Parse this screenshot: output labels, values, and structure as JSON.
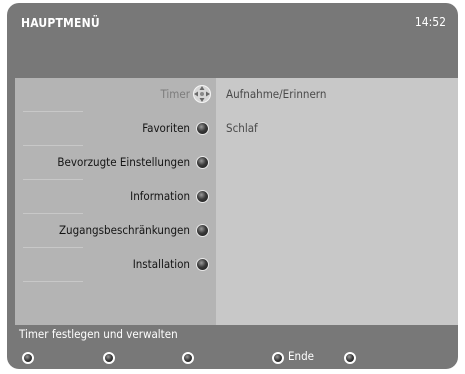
{
  "header": {
    "title": "HAUPTMENÜ",
    "time": "14:52"
  },
  "menu": {
    "items": [
      {
        "label": "Timer",
        "selected": true
      },
      {
        "label": "Favoriten"
      },
      {
        "label": "Bevorzugte Einstellungen"
      },
      {
        "label": "Information"
      },
      {
        "label": "Zugangsbeschränkungen"
      },
      {
        "label": "Installation"
      }
    ]
  },
  "submenu": {
    "items": [
      "Aufnahme/Erinnern",
      "Schlaf"
    ]
  },
  "status": {
    "text": "Timer festlegen und verwalten"
  },
  "buttons": {
    "end_label": "Ende"
  },
  "colors": {
    "frame": "#787878",
    "menu_bg": "#b4b4b4",
    "panel_bg": "#c8c8c8"
  }
}
